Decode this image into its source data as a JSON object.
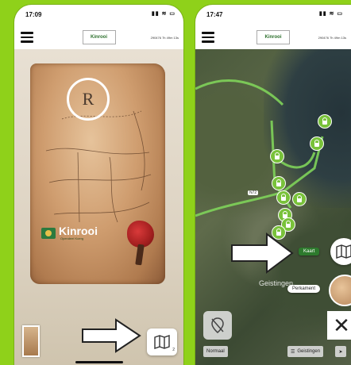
{
  "colors": {
    "accent": "#8fd11a",
    "pin_green": "#79c23a",
    "route_green": "#7fd35a"
  },
  "left_screen": {
    "status_time": "17:09",
    "status_icons": "▮▮ ≋ ▭",
    "logo_text": "Kinrooi",
    "timer": "290476 7h 49m 13s",
    "parchment_letter": "R",
    "brand_name": "Kinrooi",
    "brand_sub": "Opendeel Koerg",
    "map_button_icon": "map-icon",
    "map_button_badge": "2"
  },
  "right_screen": {
    "status_time": "17:47",
    "status_icons": "▮▮ ≋ ▭",
    "logo_text": "Kinrooi",
    "timer": "290476 7h 49m 13s",
    "road_badge": "N72",
    "town_label": "Geistingen",
    "kaart_label": "Kaart",
    "perkament_label": "Perkament",
    "close_symbol": "✕",
    "normaal_label": "Normaal",
    "geistingen_label": "Geistingen",
    "map_button_icon": "map-icon",
    "location_button_icon": "location-off-icon"
  }
}
